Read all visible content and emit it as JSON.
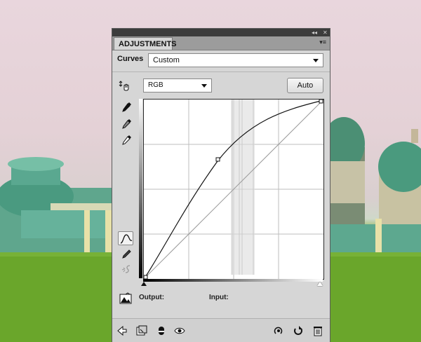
{
  "panel": {
    "tab_title": "ADJUSTMENTS",
    "adjustment_name": "Curves",
    "preset_value": "Custom",
    "channel_value": "RGB",
    "auto_label": "Auto",
    "output_label": "Output:",
    "input_label": "Input:"
  },
  "icons": {
    "collapse": "collapse-icon",
    "close": "close-icon",
    "panel_menu": "panel-menu-icon",
    "on_image_adjust": "on-image-adjust-icon",
    "black_point": "black-point-eyedropper-icon",
    "gray_point": "gray-point-eyedropper-icon",
    "white_point": "white-point-eyedropper-icon",
    "curve_edit": "curve-points-icon",
    "pencil": "pencil-icon",
    "smooth": "smooth-icon",
    "clipping_warning": "clipping-warning-icon",
    "back": "back-arrow-icon",
    "expand_view": "expand-view-icon",
    "clip_to_layer": "clip-to-layer-icon",
    "visibility": "eye-icon",
    "previous_state": "previous-state-icon",
    "reset": "reset-icon",
    "delete": "trash-icon"
  }
}
